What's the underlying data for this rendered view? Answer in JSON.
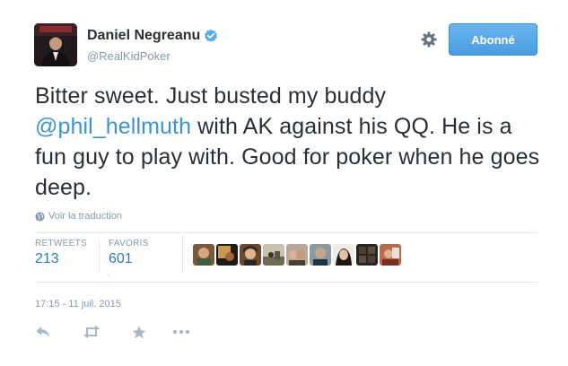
{
  "user": {
    "name": "Daniel Negreanu",
    "handle": "@RealKidPoker"
  },
  "follow_button": {
    "label": "Abonné"
  },
  "tweet": {
    "text_before": "Bitter sweet. Just busted my buddy ",
    "mention": "@phil_hellmuth",
    "text_after": " with AK against his QQ. He is a fun guy to play with. Good for poker when he goes deep."
  },
  "translate_link": "Voir la traduction",
  "stats": {
    "retweets_label": "RETWEETS",
    "retweets_value": "213",
    "favorites_label": "FAVORIS",
    "favorites_value": "601"
  },
  "favoriter_avatars": 9,
  "timestamp": "17:15 - 11 juil. 2015",
  "actions": [
    "reply-icon",
    "retweet-icon",
    "favorite-icon",
    "more-icon"
  ],
  "colors": {
    "link": "#3b94d9",
    "stat_value": "#2b7bb9",
    "muted": "#8899a6",
    "follow_button": "#55acee",
    "verified": "#55acee"
  }
}
